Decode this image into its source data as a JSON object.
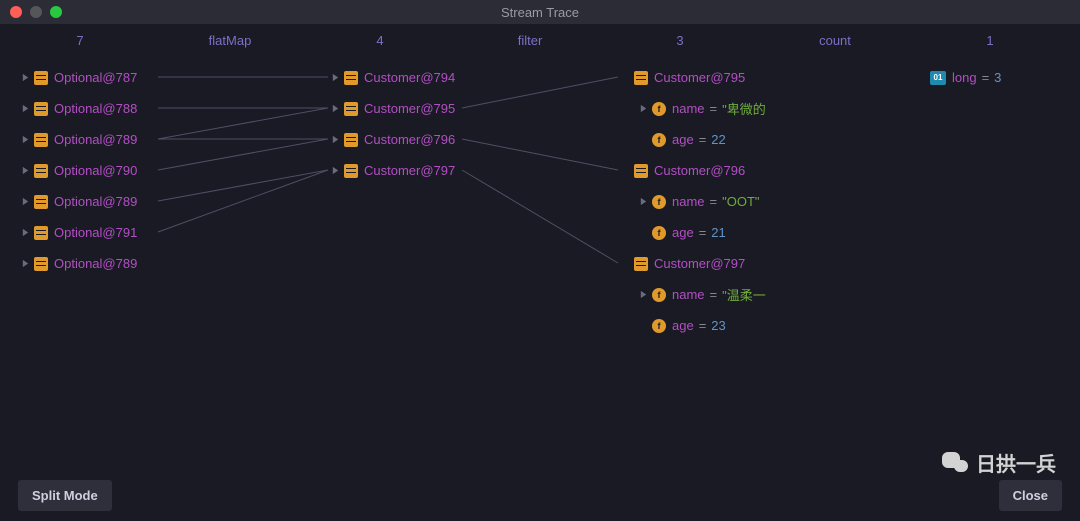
{
  "window": {
    "title": "Stream Trace"
  },
  "headers": {
    "c0": "7",
    "s0": "flatMap",
    "c1": "4",
    "s1": "filter",
    "c2": "3",
    "s2": "count",
    "c3": "1"
  },
  "col0": [
    "Optional@787",
    "Optional@788",
    "Optional@789",
    "Optional@790",
    "Optional@789",
    "Optional@791",
    "Optional@789"
  ],
  "col1": [
    "Customer@794",
    "Customer@795",
    "Customer@796",
    "Customer@797"
  ],
  "col2": [
    {
      "obj": "Customer@795",
      "name": "\"卑微的",
      "age": "22"
    },
    {
      "obj": "Customer@796",
      "name": "\"OOT\"",
      "age": "21"
    },
    {
      "obj": "Customer@797",
      "name": "\"温柔一",
      "age": "23"
    }
  ],
  "fieldLabels": {
    "name": "name",
    "age": "age"
  },
  "result": {
    "type": "long",
    "value": "3",
    "iconText": "01"
  },
  "buttons": {
    "split": "Split Mode",
    "close": "Close"
  },
  "watermark": "日拱一兵"
}
